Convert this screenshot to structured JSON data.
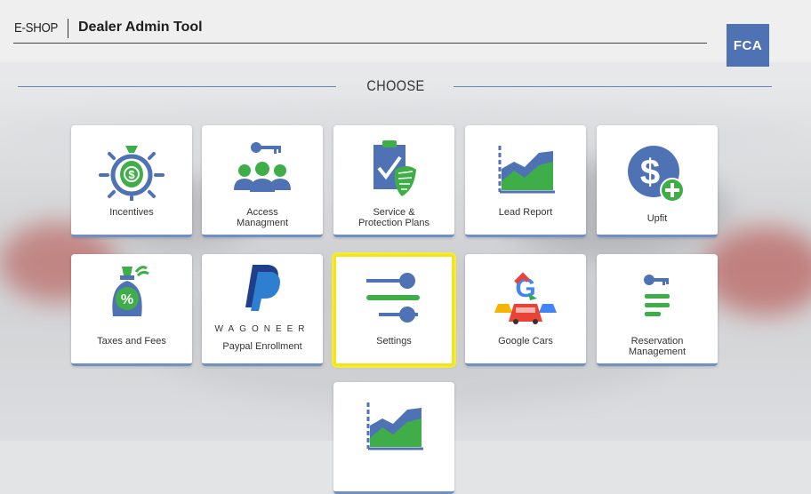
{
  "header": {
    "brand_prefix": "E-SHOP",
    "title": "Dealer Admin Tool",
    "logo_text": "FCA"
  },
  "section_title": "CHOOSE",
  "tiles": [
    {
      "label": "Incentives",
      "icon": "money-bag-target-icon"
    },
    {
      "label": "Access\nManagment",
      "icon": "key-users-icon"
    },
    {
      "label": "Service &\nProtection Plans",
      "icon": "clipboard-shield-icon"
    },
    {
      "label": "Lead Report",
      "icon": "area-chart-icon"
    },
    {
      "label": "Upfit",
      "icon": "dollar-plus-icon"
    },
    {
      "label": "Taxes and Fees",
      "icon": "percent-bag-icon"
    },
    {
      "label": "Paypal Enrollment",
      "icon": "paypal-icon",
      "sub_text": "WAGONEER"
    },
    {
      "label": "Settings",
      "icon": "sliders-icon"
    },
    {
      "label": "Google Cars",
      "icon": "google-cars-icon"
    },
    {
      "label": "Reservation\nManagement",
      "icon": "key-list-icon"
    },
    {
      "label": "",
      "icon": "area-chart-icon"
    }
  ],
  "colors": {
    "accent": "#4f72b5",
    "green": "#3fae49",
    "selected_outline": "#f1e51d"
  }
}
